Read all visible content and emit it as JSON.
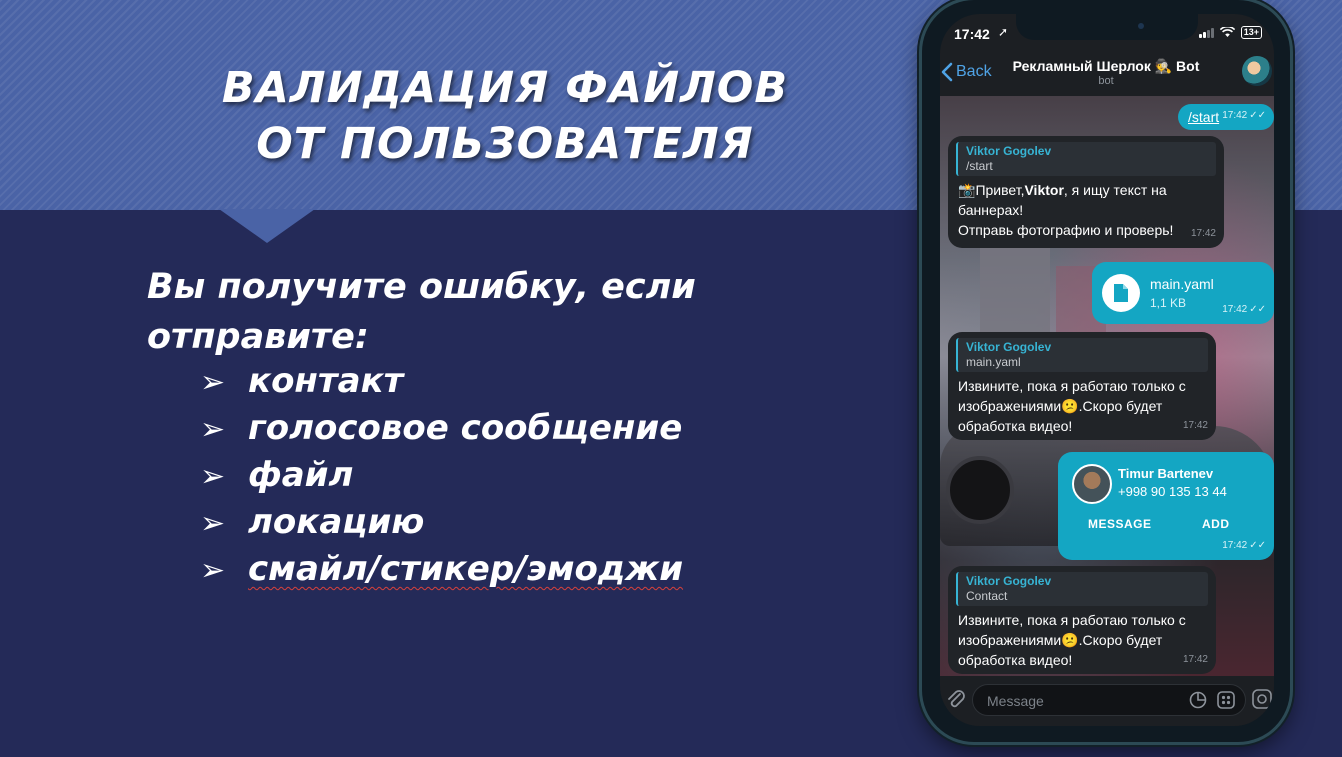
{
  "slide": {
    "title_line1": "ВАЛИДАЦИЯ ФАЙЛОВ",
    "title_line2": "ОТ ПОЛЬЗОВАТЕЛЯ",
    "lead": "Вы получите ошибку, если отправите:",
    "bullet_glyph": "➢",
    "bullets": [
      "контакт",
      "голосовое сообщение",
      "файл",
      "локацию",
      "смайл/стикер/эмоджи"
    ]
  },
  "phone": {
    "status": {
      "time": "17:42",
      "battery": "13+"
    },
    "header": {
      "back_label": "Back",
      "title": "Рекламный Шерлок 🕵 Bot",
      "subtitle": "bot"
    },
    "messages": {
      "start_cmd": {
        "text": "/start",
        "time": "17:42"
      },
      "greeting": {
        "reply_name": "Viktor Gogolev",
        "reply_text": "/start",
        "emoji": "📸",
        "pre": "Привет,",
        "user": "Viktor",
        "post": ", я ищу текст на баннерах!",
        "line2": "Отправь фотографию и проверь!",
        "time": "17:42"
      },
      "file": {
        "name": "main.yaml",
        "size": "1,1 KB",
        "time": "17:42"
      },
      "reply_file": {
        "reply_name": "Viktor Gogolev",
        "reply_text": "main.yaml",
        "text_a": "Извините, пока я работаю только с изображениями",
        "emoji": "😕",
        "text_b": ".Скоро будет обработка видео!",
        "time": "17:42"
      },
      "contact": {
        "name": "Timur Bartenev",
        "phone": "+998 90 135 13 44",
        "message_label": "MESSAGE",
        "add_label": "ADD",
        "time": "17:42"
      },
      "reply_contact": {
        "reply_name": "Viktor Gogolev",
        "reply_text": "Contact",
        "text_a": "Извините, пока я работаю только с изображениями",
        "emoji": "😕",
        "text_b": ".Скоро будет обработка видео!",
        "time": "17:42"
      }
    },
    "composer": {
      "placeholder": "Message"
    }
  },
  "colors": {
    "slide_bg": "#242a58",
    "band": "#4a63a6",
    "accent": "#14a6c3",
    "link_blue": "#4fa3e6",
    "wavy_underline": "#d9413b"
  },
  "icons": [
    "chevron-left-icon",
    "attach-icon",
    "sticker-icon",
    "commands-icon",
    "camera-icon",
    "file-icon",
    "double-check-icon",
    "wifi-icon",
    "signal-icon",
    "location-arrow-icon"
  ]
}
